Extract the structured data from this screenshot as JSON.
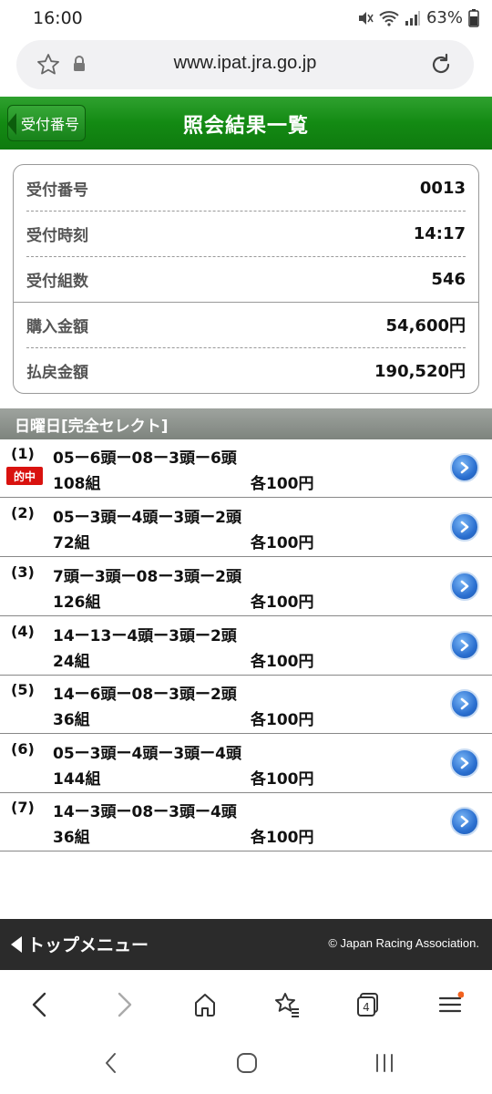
{
  "status": {
    "time": "16:00",
    "battery": "63%"
  },
  "browser": {
    "url": "www.ipat.jra.go.jp",
    "tab_count": "4"
  },
  "header": {
    "back_label": "受付番号",
    "title": "照会結果一覧"
  },
  "summary": {
    "rows": [
      {
        "label": "受付番号",
        "value": "0013"
      },
      {
        "label": "受付時刻",
        "value": "14:17"
      },
      {
        "label": "受付組数",
        "value": "546"
      },
      {
        "label": "購入金額",
        "value": "54,600円"
      },
      {
        "label": "払戻金額",
        "value": "190,520円"
      }
    ]
  },
  "section": {
    "title": "日曜日[完全セレクト]"
  },
  "bets": [
    {
      "num": "(1)",
      "combo": "05ー6頭ー08ー3頭ー6頭",
      "count": "108組",
      "price": "各100円",
      "badge": "的中"
    },
    {
      "num": "(2)",
      "combo": "05ー3頭ー4頭ー3頭ー2頭",
      "count": "72組",
      "price": "各100円"
    },
    {
      "num": "(3)",
      "combo": "7頭ー3頭ー08ー3頭ー2頭",
      "count": "126組",
      "price": "各100円"
    },
    {
      "num": "(4)",
      "combo": "14ー13ー4頭ー3頭ー2頭",
      "count": "24組",
      "price": "各100円"
    },
    {
      "num": "(5)",
      "combo": "14ー6頭ー08ー3頭ー2頭",
      "count": "36組",
      "price": "各100円"
    },
    {
      "num": "(6)",
      "combo": "05ー3頭ー4頭ー3頭ー4頭",
      "count": "144組",
      "price": "各100円"
    },
    {
      "num": "(7)",
      "combo": "14ー3頭ー08ー3頭ー4頭",
      "count": "36組",
      "price": "各100円"
    }
  ],
  "footer": {
    "menu_label": "トップメニュー",
    "copyright": "© Japan Racing Association."
  },
  "icons": {
    "accent_green": "#138a13",
    "hit_red": "#d9120f",
    "go_blue": "#2a6fd0"
  }
}
